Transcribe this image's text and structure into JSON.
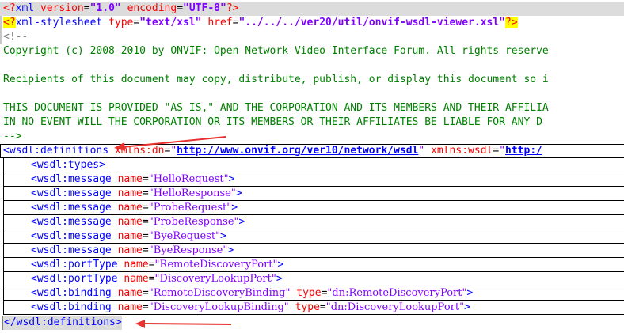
{
  "xml_decl": {
    "open": "<?",
    "name": "xml",
    "attr1": "version",
    "val1": "\"1.0\"",
    "attr2": "encoding",
    "val2": "\"UTF-8\"",
    "close": "?>"
  },
  "stylesheet": {
    "open": "<?",
    "name": "xml-stylesheet",
    "attr1": "type",
    "val1": "\"text/xsl\"",
    "attr2": "href",
    "val2": "\"../../../ver20/util/onvif-wsdl-viewer.xsl\"",
    "close": "?>"
  },
  "comment": {
    "open": "<!--",
    "copyright": "Copyright (c) 2008-2010 by ONVIF: Open Network Video Interface Forum. All rights reserve",
    "recipients": "Recipients of this document may copy, distribute, publish, or display this document so i",
    "provided": "THIS DOCUMENT IS PROVIDED \"AS IS,\" AND THE CORPORATION AND ITS MEMBERS AND THEIR AFFILIA",
    "no_event": "IN NO EVENT WILL THE CORPORATION OR ITS MEMBERS OR THEIR AFFILIATES BE LIABLE FOR ANY D",
    "close": "-->"
  },
  "definitions": {
    "open": "<wsdl:definitions",
    "attr1": "xmlns:dn",
    "val1": "http://www.onvif.org/ver10/network/wsdl",
    "attr2": "xmlns:wsdl",
    "val2": "http:/",
    "close_tag": "</wsdl:definitions>"
  },
  "children": [
    {
      "tag": "<wsdl:types>"
    },
    {
      "tag": "<wsdl:message",
      "attr": "name",
      "value": "HelloRequest",
      "end": ">"
    },
    {
      "tag": "<wsdl:message",
      "attr": "name",
      "value": "HelloResponse",
      "end": ">"
    },
    {
      "tag": "<wsdl:message",
      "attr": "name",
      "value": "ProbeRequest",
      "end": ">"
    },
    {
      "tag": "<wsdl:message",
      "attr": "name",
      "value": "ProbeResponse",
      "end": ">"
    },
    {
      "tag": "<wsdl:message",
      "attr": "name",
      "value": "ByeRequest",
      "end": ">"
    },
    {
      "tag": "<wsdl:message",
      "attr": "name",
      "value": "ByeResponse",
      "end": ">"
    },
    {
      "tag": "<wsdl:portType",
      "attr": "name",
      "value": "RemoteDiscoveryPort",
      "end": ">"
    },
    {
      "tag": "<wsdl:portType",
      "attr": "name",
      "value": "DiscoveryLookupPort",
      "end": ">"
    },
    {
      "tag": "<wsdl:binding",
      "attr": "name",
      "value": "RemoteDiscoveryBinding",
      "attr2": "type",
      "value2": "dn:RemoteDiscoveryPort",
      "end": ">"
    },
    {
      "tag": "<wsdl:binding",
      "attr": "name",
      "value": "DiscoveryLookupBinding",
      "attr2": "type",
      "value2": "dn:DiscoveryLookupPort",
      "end": ">"
    }
  ],
  "colors": {
    "tag": "#0000ff",
    "attribute": "#ff0000",
    "value": "#8000ff",
    "comment": "#008000",
    "arrow": "#e8312f",
    "highlight": "#ffff00"
  },
  "icons": [
    "red-arrow-icon"
  ]
}
